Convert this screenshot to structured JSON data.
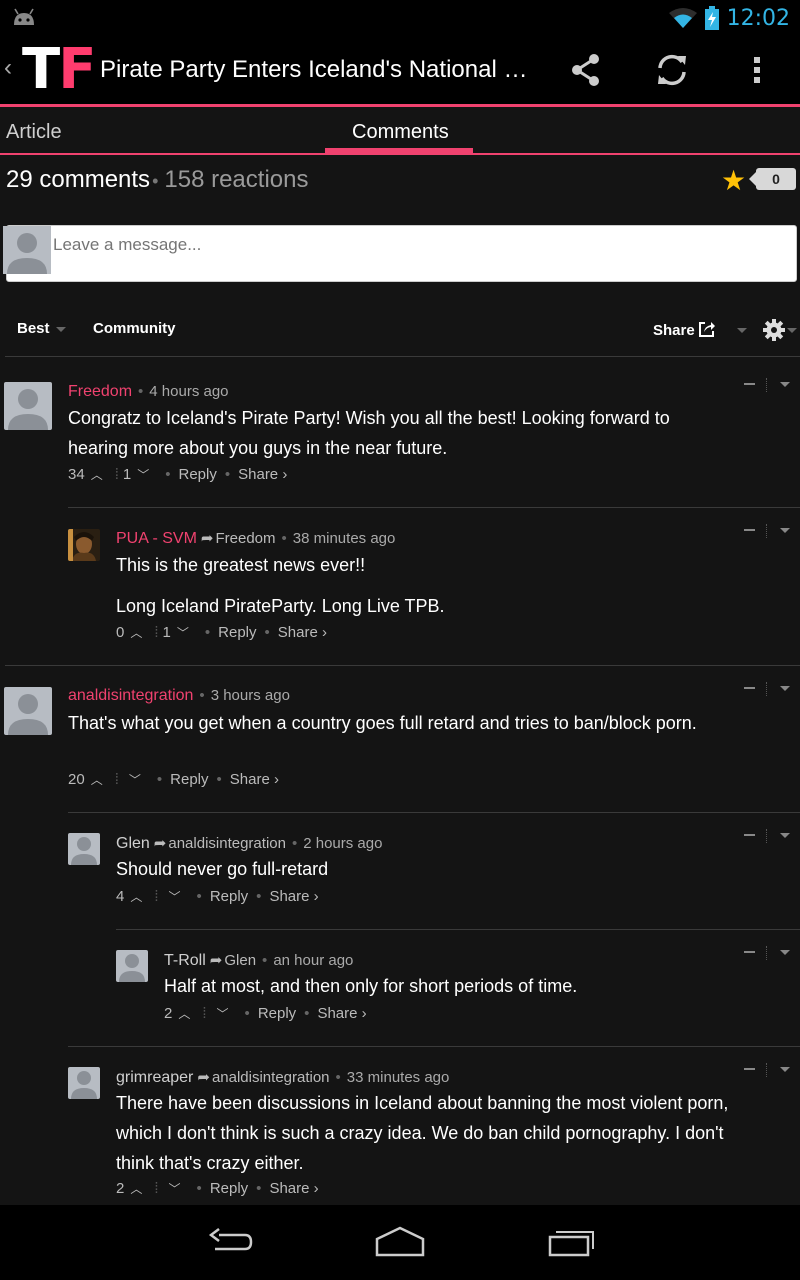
{
  "status_bar": {
    "time": "12:02",
    "icons": [
      "android-icon",
      "wifi-icon",
      "battery-charging-icon"
    ]
  },
  "action_bar": {
    "logo_t": "T",
    "logo_f": "F",
    "title": "Pirate Party Enters Iceland's National Parliament",
    "icons": [
      "share-icon",
      "refresh-icon",
      "overflow-menu-icon"
    ]
  },
  "tabs": {
    "article": "Article",
    "comments": "Comments"
  },
  "header": {
    "comments_count": "29 comments",
    "reactions_count": "158 reactions",
    "star_count": "0"
  },
  "composer": {
    "placeholder": "Leave a message..."
  },
  "sort": {
    "best": "Best",
    "community": "Community",
    "share": "Share"
  },
  "colors": {
    "accent": "#f0426f",
    "background": "#141414",
    "star": "#ffc107",
    "time": "#33b5e5"
  },
  "comments": [
    {
      "author": "Freedom",
      "parent": "",
      "time": "4 hours ago",
      "text": [
        "Congratz to Iceland's Pirate Party! Wish you all the best! Looking forward to hearing more about you guys in the near future."
      ],
      "upvotes": "34",
      "downvotes": "1",
      "reply": "Reply",
      "share": "Share ›"
    },
    {
      "author": "PUA - SVM",
      "parent": "Freedom",
      "time": "38 minutes ago",
      "text": [
        "This is the greatest news ever!!",
        "Long Iceland PirateParty. Long Live TPB."
      ],
      "upvotes": "0",
      "downvotes": "1",
      "reply": "Reply",
      "share": "Share ›"
    },
    {
      "author": "analdisintegration",
      "parent": "",
      "time": "3 hours ago",
      "text": [
        "That's what you get when a country goes full retard and tries to ban/block porn."
      ],
      "upvotes": "20",
      "downvotes": "",
      "reply": "Reply",
      "share": "Share ›"
    },
    {
      "author": "Glen",
      "parent": "analdisintegration",
      "time": "2 hours ago",
      "text": [
        "Should never go full-retard"
      ],
      "upvotes": "4",
      "downvotes": "",
      "reply": "Reply",
      "share": "Share ›"
    },
    {
      "author": "T-Roll",
      "parent": "Glen",
      "time": "an hour ago",
      "text": [
        "Half at most, and then only for short periods of time."
      ],
      "upvotes": "2",
      "downvotes": "",
      "reply": "Reply",
      "share": "Share ›"
    },
    {
      "author": "grimreaper",
      "parent": "analdisintegration",
      "time": "33 minutes ago",
      "text": [
        "There have been discussions in Iceland about banning the most violent porn, which I don't think is such a crazy idea. We do ban child pornography. I don't think that's crazy either."
      ],
      "upvotes": "2",
      "downvotes": "",
      "reply": "Reply",
      "share": "Share ›"
    }
  ],
  "nav_bar": {
    "icons": [
      "back-icon",
      "home-icon",
      "recent-apps-icon"
    ]
  }
}
